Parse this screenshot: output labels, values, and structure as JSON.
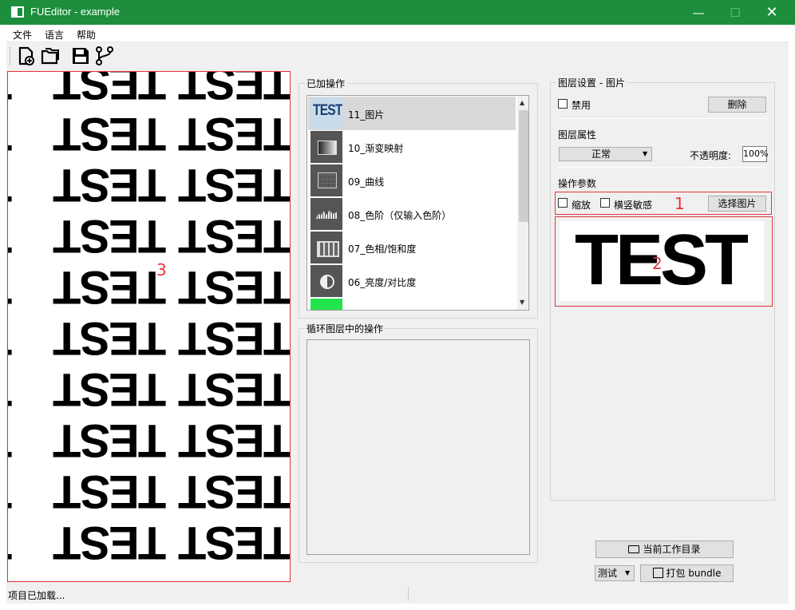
{
  "window": {
    "title": "FUEditor - example",
    "minimize_icon": "minimize-icon",
    "maximize_icon": "maximize-icon",
    "close_icon": "close-icon"
  },
  "menu": [
    "文件",
    "语言",
    "帮助"
  ],
  "toolbar": [
    "new-file-icon",
    "open-folder-icon",
    "save-icon",
    "branch-icon"
  ],
  "canvas": {
    "pattern_text": "TEST",
    "marker": "3"
  },
  "ops_panel": {
    "title": "已加操作",
    "items": [
      {
        "label": "11_图片",
        "thumb_text": "TEST",
        "selected": true
      },
      {
        "label": "10_渐变映射"
      },
      {
        "label": "09_曲线"
      },
      {
        "label": "08_色阶（仅输入色阶）"
      },
      {
        "label": "07_色相/饱和度"
      },
      {
        "label": "06_亮度/对比度"
      }
    ],
    "partial_thumb_color": "#22e54e"
  },
  "loop_panel": {
    "title": "循环图层中的操作"
  },
  "layer_panel": {
    "title": "图层设置 - 图片",
    "disable_label": "禁用",
    "delete_button": "删除",
    "props_label": "图层属性",
    "blend_mode": "正常",
    "opacity_label": "不透明度:",
    "opacity_value": "100%",
    "params_label": "操作参数",
    "scale_label": "缩放",
    "orient_label": "横竖敏感",
    "choose_image_button": "选择图片",
    "marker_1": "1",
    "preview_text": "TEST",
    "marker_2": "2"
  },
  "bottom": {
    "workdir_button": "当前工作目录",
    "test_select": "测试",
    "pack_button": "打包 bundle"
  },
  "status": {
    "text": "项目已加载..."
  },
  "colors": {
    "titlebar": "#1d8f3c",
    "annotation": "#e0363b"
  }
}
